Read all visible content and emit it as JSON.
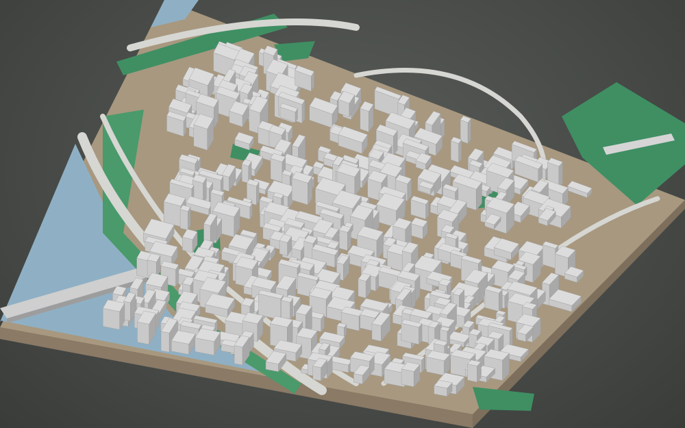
{
  "colors": {
    "background": "#4a4d4a",
    "base_side": "#8a7a66",
    "base_top": "#a8987f",
    "water": "#8fb0c4",
    "park": "#3f8f63",
    "building_top": "#dcdcdc",
    "building_light": "#c9c9c9",
    "building_dark": "#a9a9a9",
    "road": "#d6d6d2"
  },
  "features": {
    "rivers": [
      "river-west",
      "river-northeast"
    ],
    "bridges": [
      "arched-bridge-west",
      "footbridge-east"
    ],
    "parks": [
      "park-north",
      "park-east",
      "park-south",
      "park-inner"
    ]
  }
}
